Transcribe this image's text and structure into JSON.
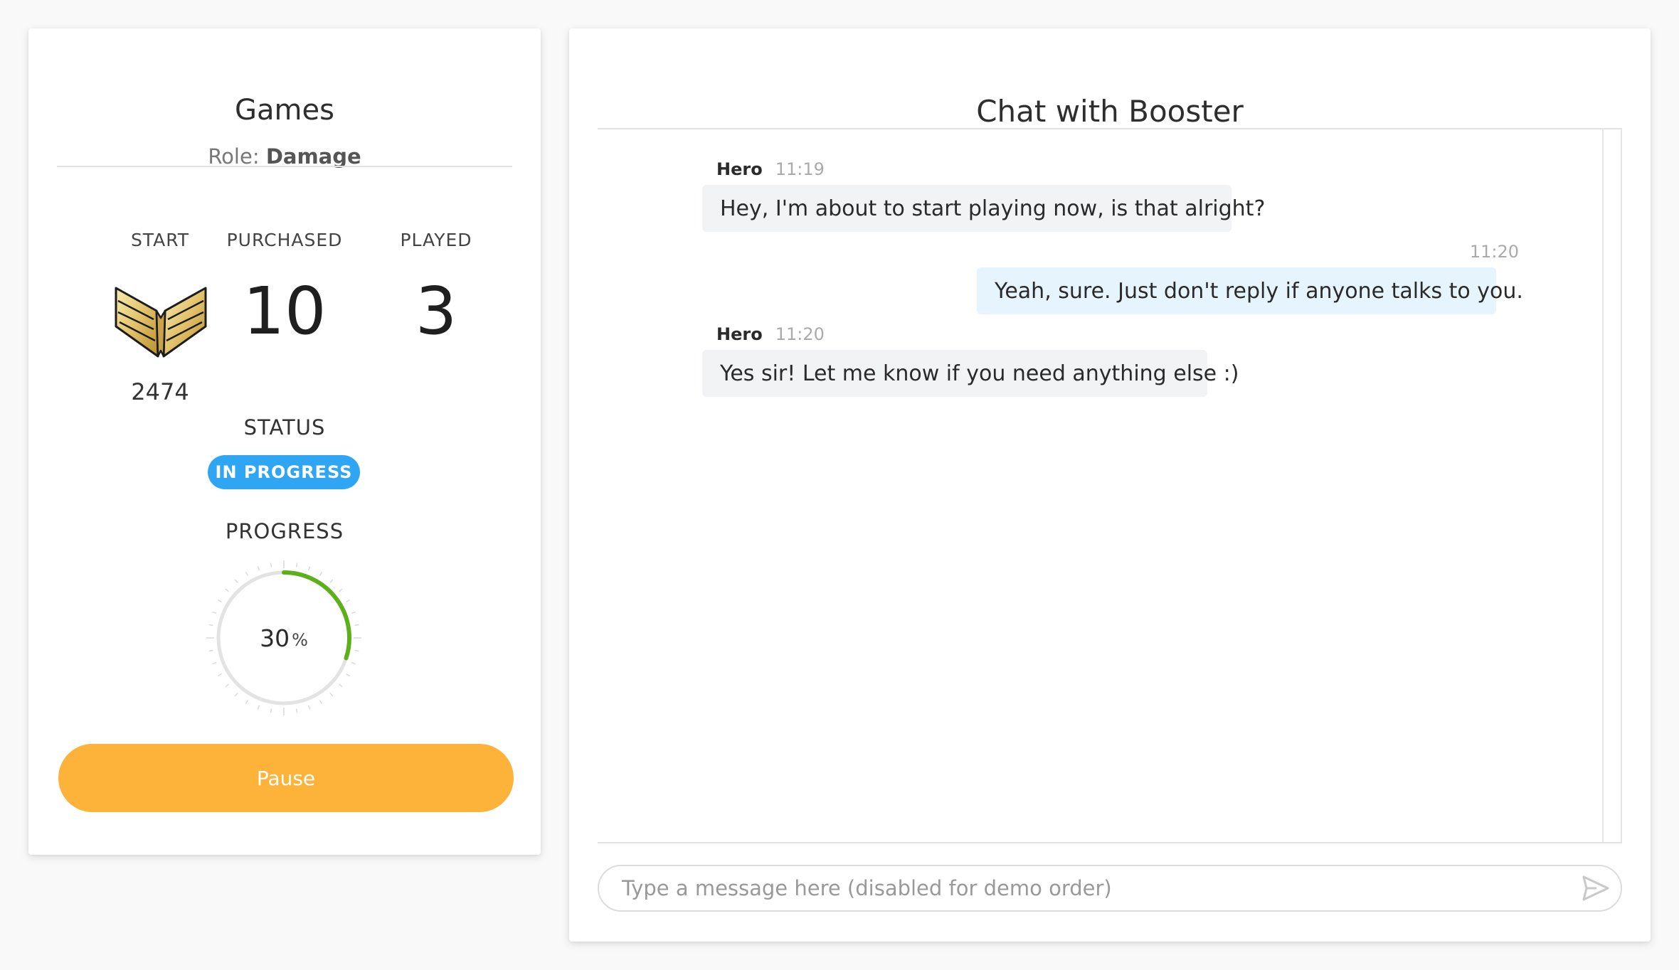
{
  "games": {
    "title": "Games",
    "role_prefix": "Role:",
    "role_value": "Damage",
    "stats": {
      "start_label": "START",
      "start_rank_icon": "rank-wings-icon",
      "start_value": "2474",
      "purchased_label": "PURCHASED",
      "purchased_value": "10",
      "played_label": "PLAYED",
      "played_value": "3"
    },
    "status_label": "STATUS",
    "status_badge": "IN PROGRESS",
    "progress_label": "PROGRESS",
    "progress_value": "30",
    "progress_unit": "%",
    "progress_fraction": 0.3,
    "pause_label": "Pause",
    "colors": {
      "badge": "#2fa6f3",
      "progress_arc": "#5cb11a",
      "pause_button": "#fdb23a"
    }
  },
  "chat": {
    "title": "Chat with Booster",
    "messages": [
      {
        "sender": "Hero",
        "time": "11:19",
        "text": "Hey, I'm about to start playing now, is that alright?",
        "direction": "incoming"
      },
      {
        "sender": "",
        "time": "11:20",
        "text": "Yeah, sure. Just don't reply if anyone talks to you.",
        "direction": "outgoing"
      },
      {
        "sender": "Hero",
        "time": "11:20",
        "text": "Yes sir! Let me know if you need anything else :)",
        "direction": "incoming"
      }
    ],
    "input_placeholder": "Type a message here (disabled for demo order)",
    "send_icon": "send-icon"
  }
}
